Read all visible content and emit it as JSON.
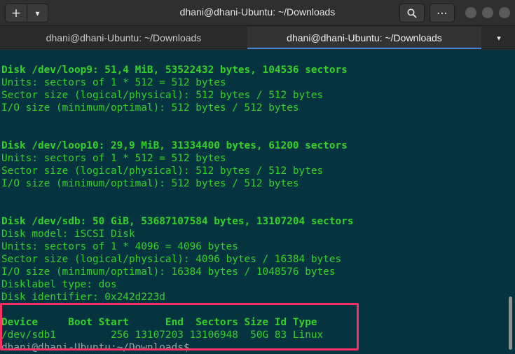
{
  "window": {
    "title": "dhani@dhani-Ubuntu: ~/Downloads",
    "new_tab_icon": "+",
    "dropdown_icon": "▾",
    "search_icon": "search",
    "menu_icon": "⋯"
  },
  "tabs": [
    {
      "label": "dhani@dhani-Ubuntu: ~/Downloads"
    },
    {
      "label": "dhani@dhani-Ubuntu: ~/Downloads"
    }
  ],
  "tab_menu_icon": "▾",
  "terminal": {
    "lines": [
      {
        "text": "Disk /dev/loop9: 51,4 MiB, 53522432 bytes, 104536 sectors",
        "bold": true
      },
      {
        "text": "Units: sectors of 1 * 512 = 512 bytes"
      },
      {
        "text": "Sector size (logical/physical): 512 bytes / 512 bytes"
      },
      {
        "text": "I/O size (minimum/optimal): 512 bytes / 512 bytes"
      },
      {
        "text": ""
      },
      {
        "text": ""
      },
      {
        "text": "Disk /dev/loop10: 29,9 MiB, 31334400 bytes, 61200 sectors",
        "bold": true
      },
      {
        "text": "Units: sectors of 1 * 512 = 512 bytes"
      },
      {
        "text": "Sector size (logical/physical): 512 bytes / 512 bytes"
      },
      {
        "text": "I/O size (minimum/optimal): 512 bytes / 512 bytes"
      },
      {
        "text": ""
      },
      {
        "text": ""
      },
      {
        "text": "Disk /dev/sdb: 50 GiB, 53687107584 bytes, 13107204 sectors",
        "bold": true
      },
      {
        "text": "Disk model: iSCSI Disk"
      },
      {
        "text": "Units: sectors of 1 * 4096 = 4096 bytes"
      },
      {
        "text": "Sector size (logical/physical): 4096 bytes / 16384 bytes"
      },
      {
        "text": "I/O size (minimum/optimal): 16384 bytes / 1048576 bytes"
      },
      {
        "text": "Disklabel type: dos"
      },
      {
        "text": "Disk identifier: 0x242d223d"
      },
      {
        "text": ""
      },
      {
        "text": "Device     Boot Start      End  Sectors Size Id Type",
        "bold": true
      },
      {
        "text": "/dev/sdb1         256 13107203 13106948  50G 83 Linux"
      },
      {
        "text": "dhani@dhani-Ubuntu:~/Downloads$",
        "prompt": true
      }
    ]
  },
  "colors": {
    "terminal_bg": "#053440",
    "terminal_text": "#33d12a",
    "highlight_border": "#ff2e63",
    "active_tab_accent": "#3f8ad8"
  }
}
